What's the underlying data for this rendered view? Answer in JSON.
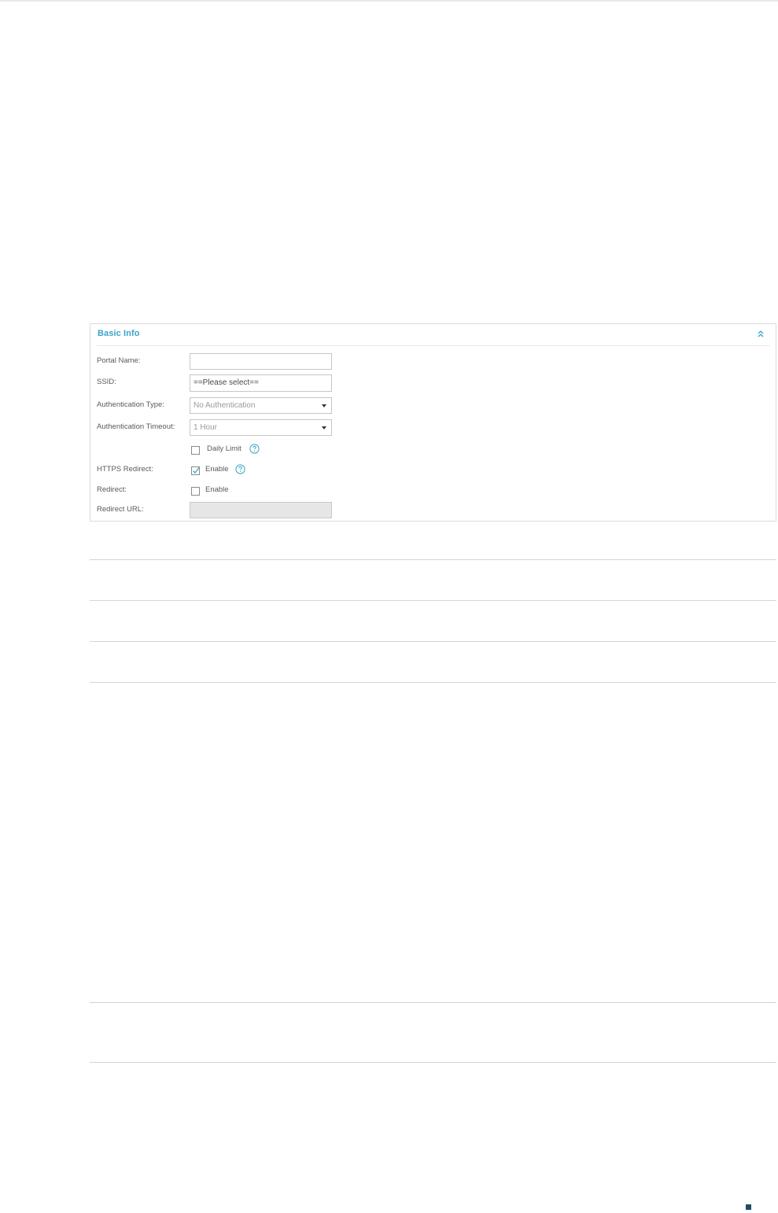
{
  "panel": {
    "title": "Basic Info",
    "accent_color": "#3aa5c8",
    "collapse_icon": "double-chevron-up-icon"
  },
  "form": {
    "portal_name": {
      "label": "Portal Name:",
      "value": ""
    },
    "ssid": {
      "label": "SSID:",
      "value": "==Please select=="
    },
    "authentication_type": {
      "label": "Authentication Type:",
      "selected": "No Authentication"
    },
    "authentication_timeout": {
      "label": "Authentication Timeout:",
      "selected": "1 Hour"
    },
    "daily_limit": {
      "label": "Daily Limit",
      "checked": false,
      "help_icon": "question-circle-icon"
    },
    "https_redirect": {
      "label": "HTTPS Redirect:",
      "option_label": "Enable",
      "checked": true,
      "help_icon": "question-circle-icon"
    },
    "redirect": {
      "label": "Redirect:",
      "option_label": "Enable",
      "checked": false
    },
    "redirect_url": {
      "label": "Redirect URL:",
      "value": "",
      "disabled": true
    }
  },
  "colors": {
    "label_text": "#5a5a5a",
    "border": "#c6c6c6",
    "disabled_bg": "#e6e6e6",
    "corner_mark": "#1f4e62"
  }
}
